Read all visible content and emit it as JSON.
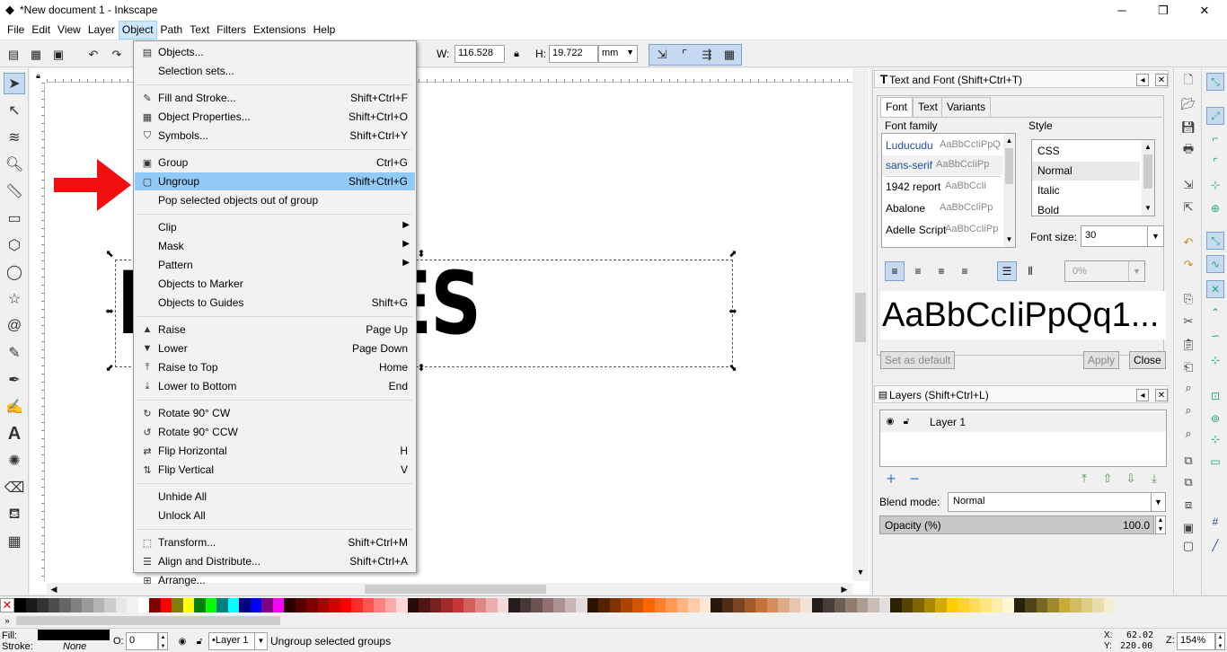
{
  "window": {
    "title": "*New document 1 - Inkscape",
    "controls": [
      "minimize-icon",
      "restore-icon",
      "close-icon"
    ]
  },
  "menubar": {
    "items": [
      "File",
      "Edit",
      "View",
      "Layer",
      "Object",
      "Path",
      "Text",
      "Filters",
      "Extensions",
      "Help"
    ],
    "active_index": 4
  },
  "toolbar": {
    "w_label": "W:",
    "w_value": "116.528",
    "h_label": "H:",
    "h_value": "19.722",
    "unit": "mm"
  },
  "canvas": {
    "text": "BUNDLES",
    "visible_text": "UNDLES",
    "arrow_color": "#ff0000"
  },
  "object_menu": {
    "items": [
      {
        "icon": "objects-icon",
        "label": "Objects...",
        "shortcut": ""
      },
      {
        "icon": "",
        "label": "Selection sets...",
        "shortcut": ""
      },
      {
        "sep": true
      },
      {
        "icon": "fill-stroke-icon",
        "label": "Fill and Stroke...",
        "shortcut": "Shift+Ctrl+F"
      },
      {
        "icon": "object-properties-icon",
        "label": "Object Properties...",
        "shortcut": "Shift+Ctrl+O"
      },
      {
        "icon": "symbols-icon",
        "label": "Symbols...",
        "shortcut": "Shift+Ctrl+Y"
      },
      {
        "sep": true
      },
      {
        "icon": "group-icon",
        "label": "Group",
        "shortcut": "Ctrl+G"
      },
      {
        "icon": "ungroup-icon",
        "label": "Ungroup",
        "shortcut": "Shift+Ctrl+G",
        "highlighted": true
      },
      {
        "icon": "",
        "label": "Pop selected objects out of group",
        "shortcut": ""
      },
      {
        "sep": true
      },
      {
        "icon": "",
        "label": "Clip",
        "shortcut": "",
        "submenu": true
      },
      {
        "icon": "",
        "label": "Mask",
        "shortcut": "",
        "submenu": true
      },
      {
        "icon": "",
        "label": "Pattern",
        "shortcut": "",
        "submenu": true
      },
      {
        "icon": "",
        "label": "Objects to Marker",
        "shortcut": ""
      },
      {
        "icon": "",
        "label": "Objects to Guides",
        "shortcut": "Shift+G"
      },
      {
        "sep": true
      },
      {
        "icon": "raise-icon",
        "label": "Raise",
        "shortcut": "Page Up"
      },
      {
        "icon": "lower-icon",
        "label": "Lower",
        "shortcut": "Page Down"
      },
      {
        "icon": "raise-to-top-icon",
        "label": "Raise to Top",
        "shortcut": "Home"
      },
      {
        "icon": "lower-to-bottom-icon",
        "label": "Lower to Bottom",
        "shortcut": "End"
      },
      {
        "sep": true
      },
      {
        "icon": "rotate-cw-icon",
        "label": "Rotate 90° CW",
        "shortcut": ""
      },
      {
        "icon": "rotate-ccw-icon",
        "label": "Rotate 90° CCW",
        "shortcut": ""
      },
      {
        "icon": "flip-horizontal-icon",
        "label": "Flip Horizontal",
        "shortcut": "H"
      },
      {
        "icon": "flip-vertical-icon",
        "label": "Flip Vertical",
        "shortcut": "V"
      },
      {
        "sep": true
      },
      {
        "icon": "",
        "label": "Unhide All",
        "shortcut": ""
      },
      {
        "icon": "",
        "label": "Unlock All",
        "shortcut": ""
      },
      {
        "sep": true
      },
      {
        "icon": "transform-icon",
        "label": "Transform...",
        "shortcut": "Shift+Ctrl+M"
      },
      {
        "icon": "align-distribute-icon",
        "label": "Align and Distribute...",
        "shortcut": "Shift+Ctrl+A"
      },
      {
        "icon": "arrange-icon",
        "label": "Arrange...",
        "shortcut": ""
      }
    ]
  },
  "text_font_dialog": {
    "title": "Text and Font (Shift+Ctrl+T)",
    "tabs": [
      "Font",
      "Text",
      "Variants"
    ],
    "font_family_label": "Font family",
    "fonts": [
      {
        "name": "Luducudu",
        "sample": "AaBbCcIiPpQ"
      },
      {
        "name": "sans-serif",
        "sample": "AaBbCcIiPp"
      },
      {
        "name": "1942 report",
        "sample": "AaBbCcIi"
      },
      {
        "name": "Abalone",
        "sample": "AaBbCcIiPp"
      },
      {
        "name": "Adelle Script",
        "sample": "AaBbCcIiPp"
      }
    ],
    "style_label": "Style",
    "styles": [
      "CSS",
      "Normal",
      "Italic",
      "Bold"
    ],
    "font_size_label": "Font size:",
    "font_size": "30",
    "spacing": "0%",
    "preview": "AaBbCcIiPpQq1...",
    "set_default": "Set as default",
    "apply": "Apply",
    "close": "Close"
  },
  "layers_dialog": {
    "title": "Layers (Shift+Ctrl+L)",
    "layer_name": "Layer 1",
    "blend_label": "Blend mode:",
    "blend_value": "Normal",
    "opacity_label": "Opacity (%)",
    "opacity_value": "100.0"
  },
  "palette": {
    "colors": [
      "#000000",
      "#1a1a1a",
      "#333333",
      "#4d4d4d",
      "#666666",
      "#808080",
      "#999999",
      "#b3b3b3",
      "#cccccc",
      "#e6e6e6",
      "#f2f2f2",
      "#ffffff",
      "#800000",
      "#ff0000",
      "#808000",
      "#ffff00",
      "#008000",
      "#00ff00",
      "#008080",
      "#00ffff",
      "#000080",
      "#0000ff",
      "#800080",
      "#ff00ff",
      "#2b0000",
      "#550000",
      "#800000",
      "#aa0000",
      "#d40000",
      "#ff0000",
      "#ff2a2a",
      "#ff5555",
      "#ff8080",
      "#ffaaaa",
      "#ffd5d5",
      "#280b0b",
      "#501616",
      "#782121",
      "#a02c2c",
      "#c83737",
      "#d35f5f",
      "#de8787",
      "#e9afaf",
      "#f4d7d7",
      "#241c1c",
      "#483737",
      "#6c5353",
      "#916f6f",
      "#ac9393",
      "#c8b7b7",
      "#e3dbdb",
      "#2b1100",
      "#552200",
      "#803300",
      "#aa4400",
      "#d45500",
      "#ff6600",
      "#ff7f2a",
      "#ff9955",
      "#ffb380",
      "#ffccaa",
      "#ffe6d5",
      "#28170b",
      "#502d16",
      "#784421",
      "#a05a2c",
      "#c87137",
      "#d38d5f",
      "#deaa87",
      "#e9c6af",
      "#f4e3d7",
      "#241f1c",
      "#483e37",
      "#6c5d53",
      "#917c6f",
      "#ac9d93",
      "#c8beb7",
      "#e3dedb",
      "#2b2200",
      "#554400",
      "#806600",
      "#aa8800",
      "#d4aa00",
      "#ffcc00",
      "#ffd42a",
      "#ffdd55",
      "#ffe680",
      "#ffeeaa",
      "#fff6d5",
      "#28220b",
      "#504416",
      "#786721",
      "#a0892c",
      "#c8ab37",
      "#d3bc5f",
      "#decd87",
      "#e9ddaf",
      "#f4eed7"
    ]
  },
  "status": {
    "fill_label": "Fill:",
    "stroke_label": "Stroke:",
    "stroke_value": "None",
    "opacity_label": "O:",
    "opacity_value": "0",
    "layer": "•Layer 1",
    "message": "Ungroup selected groups",
    "x_label": "X:",
    "x_value": "62.02",
    "y_label": "Y:",
    "y_value": "220.00",
    "z_label": "Z:",
    "zoom": "154%"
  }
}
